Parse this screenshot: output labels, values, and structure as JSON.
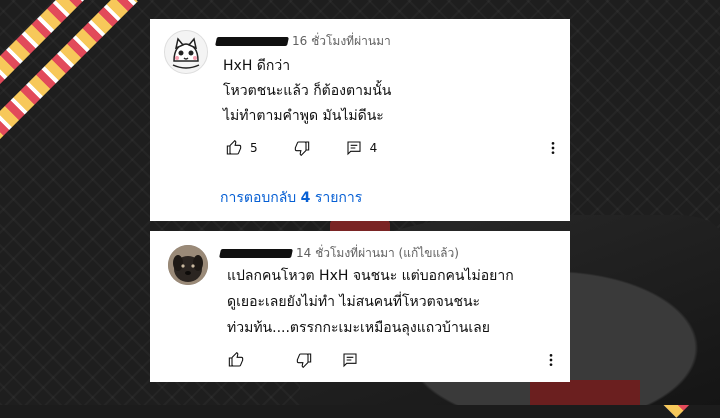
{
  "comments": [
    {
      "time": "16 ชั่วโมงที่ผ่านมา",
      "lines": [
        "HxH ดีกว่า",
        "โหวตชนะแล้ว ก็ต้องตามนั้น",
        "ไม่ทำตามคำพูด มันไม่ดีนะ"
      ],
      "likes": "5",
      "reply_count": "4",
      "replies_link_prefix": "การตอบกลับ",
      "replies_link_count": "4",
      "replies_link_suffix": "รายการ"
    },
    {
      "time": "14 ชั่วโมงที่ผ่านมา (แก้ไขแล้ว)",
      "lines": [
        "แปลกคนโหวต HxH จนชนะ แต่บอกคนไม่อยาก",
        "ดูเยอะเลยยังไม่ทำ ไม่สนคนที่โหวตจนชนะ",
        "ท่วมท้น....ตรรกกะเมะเหมือนลุงแถวบ้านเลย"
      ]
    }
  ],
  "icons": {
    "like": "thumbs-up-icon",
    "dislike": "thumbs-down-icon",
    "reply": "reply-comment-icon",
    "more": "more-vertical-icon"
  },
  "colors": {
    "link": "#065fd4",
    "meta": "#606060",
    "text": "#0f0f0f"
  }
}
